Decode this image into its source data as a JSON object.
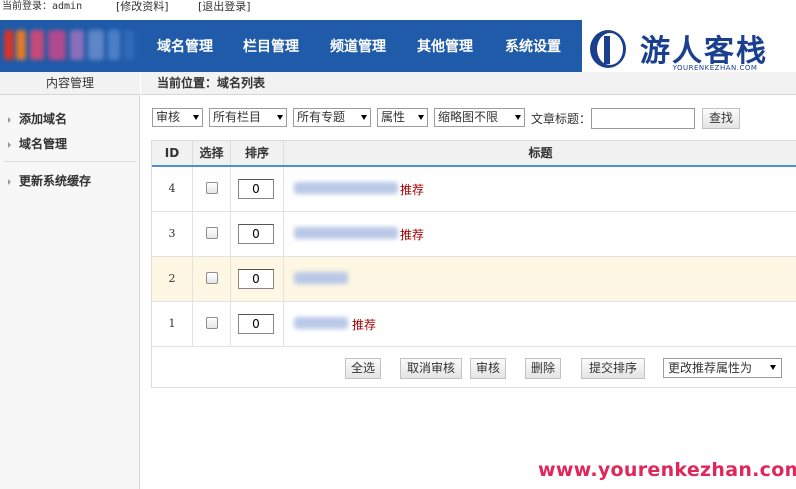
{
  "topbar": {
    "login": "当前登录：admin",
    "edit_profile": "[修改资料]",
    "logout": "[退出登录]"
  },
  "nav": {
    "items": [
      "域名管理",
      "栏目管理",
      "频道管理",
      "其他管理",
      "系统设置"
    ]
  },
  "brand": {
    "name_cn": "游人客栈",
    "name_en": "YOURENKEZHAN.COM"
  },
  "sidebar": {
    "title": "内容管理",
    "items": [
      "添加域名",
      "域名管理",
      "更新系统缓存"
    ]
  },
  "breadcrumb": "当前位置：域名列表",
  "filters": {
    "selects": [
      "审核",
      "所有栏目",
      "所有专题",
      "属性",
      "缩略图不限"
    ],
    "title_label": "文章标题：",
    "title_value": "",
    "search_button": "查找"
  },
  "table": {
    "headers": [
      "ID",
      "选择",
      "排序",
      "标题"
    ],
    "rows": [
      {
        "id": "4",
        "order": "0",
        "tag": "推荐",
        "checked": false
      },
      {
        "id": "3",
        "order": "0",
        "tag": "推荐",
        "checked": false
      },
      {
        "id": "2",
        "order": "0",
        "tag": "",
        "checked": false
      },
      {
        "id": "1",
        "order": "0",
        "tag": "推荐",
        "checked": false
      }
    ]
  },
  "actions": {
    "select_all": "全选",
    "cancel_review": "取消审核",
    "review": "审核",
    "delete": "删除",
    "submit_order": "提交排序",
    "change_attr": "更改推荐属性为"
  },
  "watermark": "www.yourenkezhan.com",
  "colors": {
    "header_bg": "#1f5ba9",
    "table_header_border": "#4a90d9",
    "highlight_row": "#fdf7e3",
    "tag_red": "#a50000",
    "watermark": "#e0265b"
  }
}
